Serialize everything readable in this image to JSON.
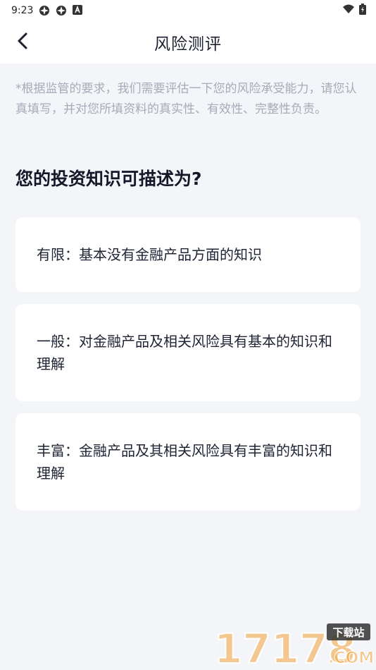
{
  "status_bar": {
    "time": "9:23",
    "icons": [
      "app-icon",
      "app-icon",
      "notification-a-icon",
      "wifi-icon",
      "battery-icon"
    ]
  },
  "header": {
    "title": "风险测评",
    "back_icon": "chevron-left-icon"
  },
  "notice": "*根据监管的要求，我们需要评估一下您的风险承受能力，请您认真填写，并对您所填资料的真实性、有效性、完整性负责。",
  "question": "您的投资知识可描述为?",
  "options": [
    {
      "label": "有限：基本没有金融产品方面的知识"
    },
    {
      "label": "一般：对金融产品及相关风险具有基本的知识和理解"
    },
    {
      "label": "丰富：金融产品及其相关风险具有丰富的知识和理解"
    }
  ],
  "watermark": {
    "number": "17178",
    "badge": "下载站",
    "suffix": ".COM"
  },
  "colors": {
    "background": "#f4f5f9",
    "card": "#ffffff",
    "notice_text": "#a7abb8",
    "title_text": "#141829",
    "watermark_orange": "#f2a23a"
  }
}
